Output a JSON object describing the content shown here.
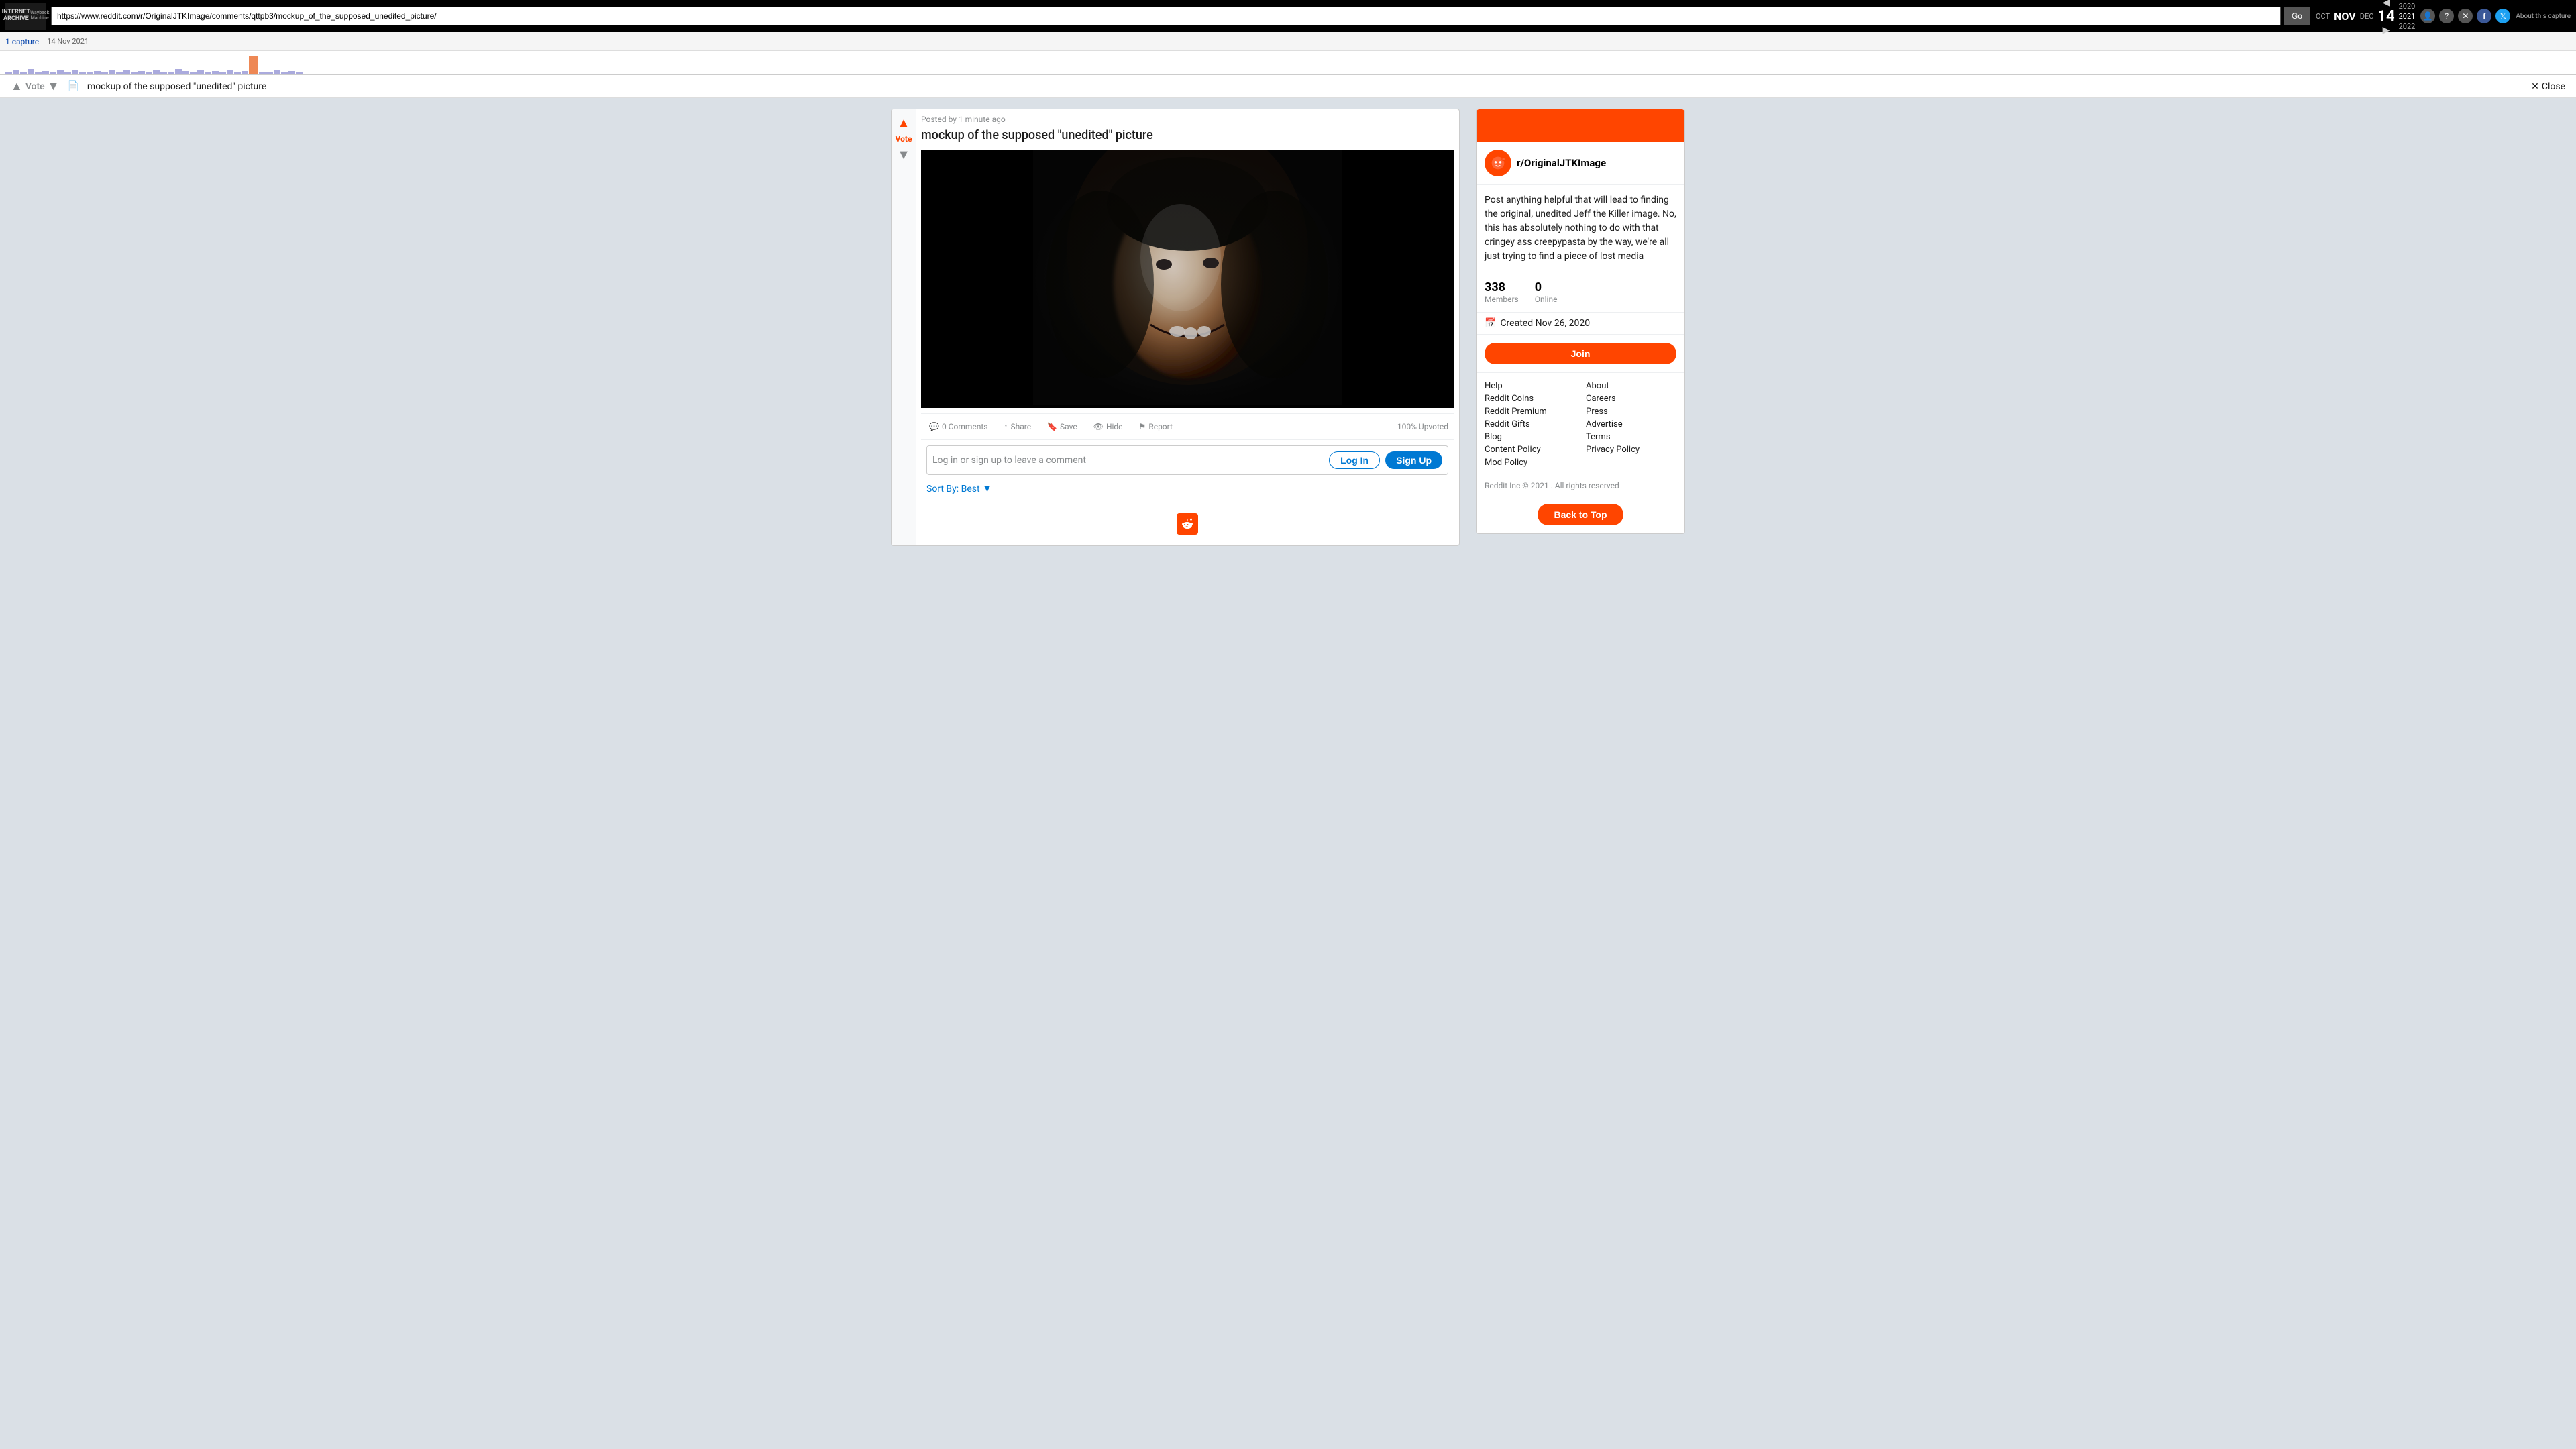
{
  "wayback": {
    "url": "https://www.reddit.com/r/OriginalJTKImage/comments/qttpb3/mockup_of_the_supposed_unedited_picture/",
    "go_label": "Go",
    "capture_count": "1 capture",
    "capture_date": "14 Nov 2021",
    "months": {
      "oct": "OCT",
      "nov": "NOV",
      "dec": "DEC"
    },
    "years": {
      "y2020": "2020",
      "y2021": "2021",
      "y2022": "2022"
    },
    "day": "14",
    "about_label": "About this capture"
  },
  "header": {
    "vote_label": "Vote",
    "post_title": "mockup of the supposed \"unedited\" picture",
    "close_label": "Close"
  },
  "post": {
    "meta": "Posted by 1 minute ago",
    "title": "mockup of the supposed \"unedited\" picture",
    "vote_label": "Vote",
    "actions": {
      "comments": "0 Comments",
      "share": "Share",
      "save": "Save",
      "hide": "Hide",
      "report": "Report"
    },
    "upvote_pct": "100% Upvoted"
  },
  "comments": {
    "prompt": "Log in or sign up to leave a comment",
    "login_label": "Log In",
    "signup_label": "Sign Up",
    "sort_label": "Sort By: Best"
  },
  "sidebar": {
    "community_name": "r/OriginalJTKImage",
    "description": "Post anything helpful that will lead to finding the original, unedited Jeff the Killer image. No, this has absolutely nothing to do with that cringey ass creepypasta by the way, we're all just trying to find a piece of lost media",
    "members_count": "338",
    "members_label": "Members",
    "online_count": "0",
    "online_label": "Online",
    "created_label": "Created Nov 26, 2020",
    "join_label": "Join",
    "footer": {
      "help": "Help",
      "about": "About",
      "reddit_coins": "Reddit Coins",
      "careers": "Careers",
      "reddit_premium": "Reddit Premium",
      "press": "Press",
      "reddit_gifts": "Reddit Gifts",
      "advertise": "Advertise",
      "blog": "Blog",
      "terms": "Terms",
      "content_policy": "Content Policy",
      "privacy_policy": "Privacy Policy",
      "mod_policy": "Mod Policy"
    },
    "copyright": "Reddit Inc © 2021 . All rights reserved"
  },
  "back_to_top": "Back to Top"
}
